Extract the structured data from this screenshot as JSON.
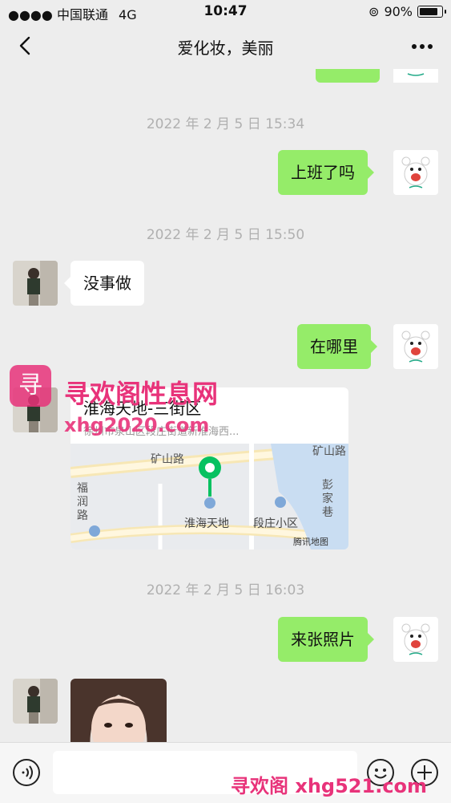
{
  "status": {
    "carrier": "中国联通",
    "network": "4G",
    "time": "10:47",
    "battery": "90%",
    "battery_level": 0.9
  },
  "nav": {
    "title": "爱化妆，美丽"
  },
  "messages": {
    "t1": "2022 年 2 月 5 日 15:34",
    "m1": "上班了吗",
    "t2": "2022 年 2 月 5 日 15:50",
    "m2": "没事做",
    "m3": "在哪里",
    "location": {
      "name": "淮海天地-三街区",
      "address": "徐州市泉山区段庄街道新淮海西...",
      "map_labels": {
        "road_top": "矿山路",
        "road_top_right": "矿山路",
        "road_left": "福润路",
        "road_right": "彭家巷",
        "poi_main": "淮海天地",
        "poi_right": "段庄小区",
        "provider": "腾讯地图"
      }
    },
    "t3": "2022 年 2 月 5 日 16:03",
    "m4": "来张照片"
  },
  "watermark": {
    "title": "寻欢阁性息网",
    "url": "xhg2020.com",
    "bottom": "寻欢阁 xhg521.com",
    "logo": "寻"
  },
  "colors": {
    "bg": "#ededed",
    "my_bubble": "#95ec69",
    "watermark": "#e8337a",
    "pin": "#07c160"
  },
  "icons": {
    "back": "chevron-left-icon",
    "more": "more-dots-icon",
    "voice": "voice-icon",
    "emoji": "emoji-icon",
    "add": "plus-icon"
  }
}
